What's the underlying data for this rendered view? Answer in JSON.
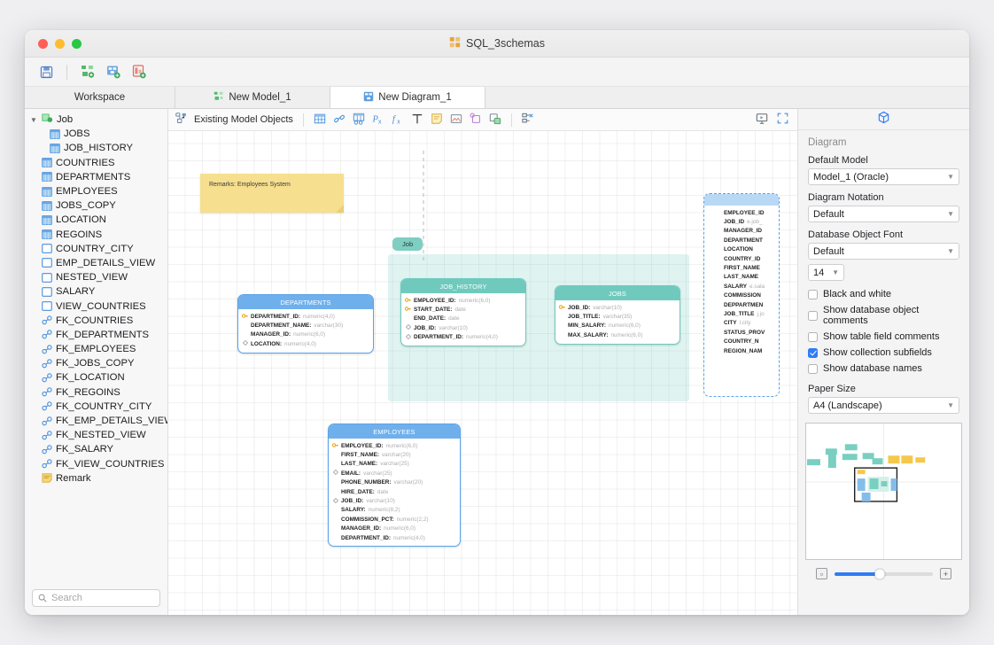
{
  "window": {
    "title": "SQL_3schemas"
  },
  "toolbar": {
    "items": [
      {
        "name": "save-icon",
        "glyph": "💾"
      },
      {
        "name": "new-model-icon",
        "glyph": ""
      },
      {
        "name": "new-diagram-icon",
        "glyph": ""
      },
      {
        "name": "new-report-icon",
        "glyph": ""
      }
    ]
  },
  "tabs": [
    {
      "label": "Workspace",
      "icon": "",
      "active": false
    },
    {
      "label": "New Model_1",
      "icon": "model-icon",
      "active": false
    },
    {
      "label": "New Diagram_1",
      "icon": "diagram-icon",
      "active": true
    }
  ],
  "sidebar": {
    "root": {
      "label": "Job",
      "icon": "model-node-icon",
      "expanded": true
    },
    "items": [
      {
        "label": "JOBS",
        "icon": "table-icon",
        "indent": 2
      },
      {
        "label": "JOB_HISTORY",
        "icon": "table-icon",
        "indent": 2
      },
      {
        "label": "COUNTRIES",
        "icon": "table-icon",
        "indent": 1
      },
      {
        "label": "DEPARTMENTS",
        "icon": "table-icon",
        "indent": 1
      },
      {
        "label": "EMPLOYEES",
        "icon": "table-icon",
        "indent": 1
      },
      {
        "label": "JOBS_COPY",
        "icon": "table-icon",
        "indent": 1
      },
      {
        "label": "LOCATION",
        "icon": "table-icon",
        "indent": 1
      },
      {
        "label": "REGOINS",
        "icon": "table-icon",
        "indent": 1
      },
      {
        "label": "COUNTRY_CITY",
        "icon": "view-icon",
        "indent": 1
      },
      {
        "label": "EMP_DETAILS_VIEW",
        "icon": "view-icon",
        "indent": 1
      },
      {
        "label": "NESTED_VIEW",
        "icon": "view-icon",
        "indent": 1
      },
      {
        "label": "SALARY",
        "icon": "view-icon",
        "indent": 1
      },
      {
        "label": "VIEW_COUNTRIES",
        "icon": "view-icon",
        "indent": 1
      },
      {
        "label": "FK_COUNTRIES",
        "icon": "key-link-icon",
        "indent": 1
      },
      {
        "label": "FK_DEPARTMENTS",
        "icon": "key-link-icon",
        "indent": 1
      },
      {
        "label": "FK_EMPLOYEES",
        "icon": "key-link-icon",
        "indent": 1
      },
      {
        "label": "FK_JOBS_COPY",
        "icon": "key-link-icon",
        "indent": 1
      },
      {
        "label": "FK_LOCATION",
        "icon": "key-link-icon",
        "indent": 1
      },
      {
        "label": "FK_REGOINS",
        "icon": "key-link-icon",
        "indent": 1
      },
      {
        "label": "FK_COUNTRY_CITY",
        "icon": "key-link-icon",
        "indent": 1
      },
      {
        "label": "FK_EMP_DETAILS_VIEW",
        "icon": "key-link-icon",
        "indent": 1
      },
      {
        "label": "FK_NESTED_VIEW",
        "icon": "key-link-icon",
        "indent": 1
      },
      {
        "label": "FK_SALARY",
        "icon": "key-link-icon",
        "indent": 1
      },
      {
        "label": "FK_VIEW_COUNTRIES",
        "icon": "key-link-icon",
        "indent": 1
      },
      {
        "label": "Remark",
        "icon": "remark-icon",
        "indent": 1
      }
    ],
    "search_placeholder": "Search"
  },
  "canvas_toolbar": {
    "existing_model_objects": "Existing Model Objects",
    "icons": [
      {
        "name": "table-tool-icon"
      },
      {
        "name": "relation-tool-icon"
      },
      {
        "name": "view-tool-icon"
      },
      {
        "name": "procedure-tool-icon"
      },
      {
        "name": "function-tool-icon"
      },
      {
        "name": "text-tool-icon"
      },
      {
        "name": "note-tool-icon"
      },
      {
        "name": "image-tool-icon"
      },
      {
        "name": "shape-tool-icon"
      },
      {
        "name": "container-tool-icon"
      },
      {
        "name": "layout-tool-icon"
      }
    ],
    "right_icons": [
      {
        "name": "presentation-icon"
      },
      {
        "name": "fullscreen-icon"
      }
    ]
  },
  "diagram": {
    "note": {
      "text": "Remarks: Employees System"
    },
    "group_tag": {
      "label": "Job"
    },
    "tables": [
      {
        "name": "DEPARTMENTS",
        "color": "blue",
        "fields": [
          {
            "icon": "key",
            "name": "DEPARTMENT_ID",
            "type": "numeric(4,0)"
          },
          {
            "icon": "none",
            "name": "DEPARTMENT_NAME",
            "type": "varchar(30)"
          },
          {
            "icon": "none",
            "name": "MANAGER_ID",
            "type": "numeric(6,0)"
          },
          {
            "icon": "diamond",
            "name": "LOCATION",
            "type": "numeric(4,0)"
          }
        ]
      },
      {
        "name": "JOB_HISTORY",
        "color": "teal",
        "fields": [
          {
            "icon": "key",
            "name": "EMPLOYEE_ID",
            "type": "numeric(6,0)"
          },
          {
            "icon": "key",
            "name": "START_DATE",
            "type": "date"
          },
          {
            "icon": "none",
            "name": "END_DATE",
            "type": "date"
          },
          {
            "icon": "diamond",
            "name": "JOB_ID",
            "type": "varchar(10)"
          },
          {
            "icon": "diamond",
            "name": "DEPARTMENT_ID",
            "type": "numeric(4,0)"
          }
        ]
      },
      {
        "name": "JOBS",
        "color": "teal",
        "fields": [
          {
            "icon": "key",
            "name": "JOB_ID",
            "type": "varchar(10)"
          },
          {
            "icon": "none",
            "name": "JOB_TITLE",
            "type": "varchar(35)"
          },
          {
            "icon": "none",
            "name": "MIN_SALARY",
            "type": "numeric(6,0)"
          },
          {
            "icon": "none",
            "name": "MAX_SALARY",
            "type": "numeric(6,0)"
          }
        ]
      },
      {
        "name": "EMPLOYEES",
        "color": "blue",
        "fields": [
          {
            "icon": "key",
            "name": "EMPLOYEE_ID",
            "type": "numeric(6,0)"
          },
          {
            "icon": "none",
            "name": "FIRST_NAME",
            "type": "varchar(20)"
          },
          {
            "icon": "none",
            "name": "LAST_NAME",
            "type": "varchar(25)"
          },
          {
            "icon": "diamond",
            "name": "EMAIL",
            "type": "varchar(25)"
          },
          {
            "icon": "none",
            "name": "PHONE_NUMBER",
            "type": "varchar(20)"
          },
          {
            "icon": "none",
            "name": "HIRE_DATE",
            "type": "date"
          },
          {
            "icon": "diamond",
            "name": "JOB_ID",
            "type": "varchar(10)"
          },
          {
            "icon": "none",
            "name": "SALARY",
            "type": "numeric(8,2)"
          },
          {
            "icon": "none",
            "name": "COMMISSION_PCT",
            "type": "numeric(2,2)"
          },
          {
            "icon": "none",
            "name": "MANAGER_ID",
            "type": "numeric(6,0)"
          },
          {
            "icon": "none",
            "name": "DEPARTMENT_ID",
            "type": "numeric(4,0)"
          }
        ]
      }
    ],
    "partial_table": {
      "fields": [
        {
          "name": "EMPLOYEE_ID",
          "type": ""
        },
        {
          "name": "JOB_ID",
          "type": "e.job_"
        },
        {
          "name": "MANAGER_ID",
          "type": ""
        },
        {
          "name": "DEPARTMENT",
          "type": ""
        },
        {
          "name": "LOCATION",
          "type": ""
        },
        {
          "name": "COUNTRY_ID",
          "type": ""
        },
        {
          "name": "FIRST_NAME",
          "type": ""
        },
        {
          "name": "LAST_NAME",
          "type": ""
        },
        {
          "name": "SALARY",
          "type": "e.sala"
        },
        {
          "name": "COMMISSION",
          "type": ""
        },
        {
          "name": "DEPPARTMEN",
          "type": ""
        },
        {
          "name": "JOB_TITLE",
          "type": "j.jo"
        },
        {
          "name": "CITY",
          "type": "l.city"
        },
        {
          "name": "STATUS_PROV",
          "type": ""
        },
        {
          "name": "COUNTRY_N",
          "type": ""
        },
        {
          "name": "REGION_NAM",
          "type": ""
        }
      ]
    }
  },
  "properties": {
    "panel_icon": "cube-icon",
    "title": "Diagram",
    "default_model_label": "Default Model",
    "default_model_value": "Model_1 (Oracle)",
    "notation_label": "Diagram Notation",
    "notation_value": "Default",
    "font_label": "Database Object Font",
    "font_value": "Default",
    "font_size_value": "14",
    "checkboxes": [
      {
        "label": "Black and white",
        "checked": false
      },
      {
        "label": "Show database object comments",
        "checked": false
      },
      {
        "label": "Show table field comments",
        "checked": false
      },
      {
        "label": "Show collection subfields",
        "checked": true
      },
      {
        "label": "Show database names",
        "checked": false
      }
    ],
    "paper_size_label": "Paper Size",
    "paper_size_value": "A4 (Landscape)",
    "zoom_out_icon": "zoom-out-icon",
    "zoom_in_icon": "zoom-in-icon"
  },
  "colors": {
    "accent": "#2f7cf6",
    "table_blue": "#6fb0ec",
    "table_teal": "#6fcabd",
    "note_yellow": "#f6df8e"
  }
}
